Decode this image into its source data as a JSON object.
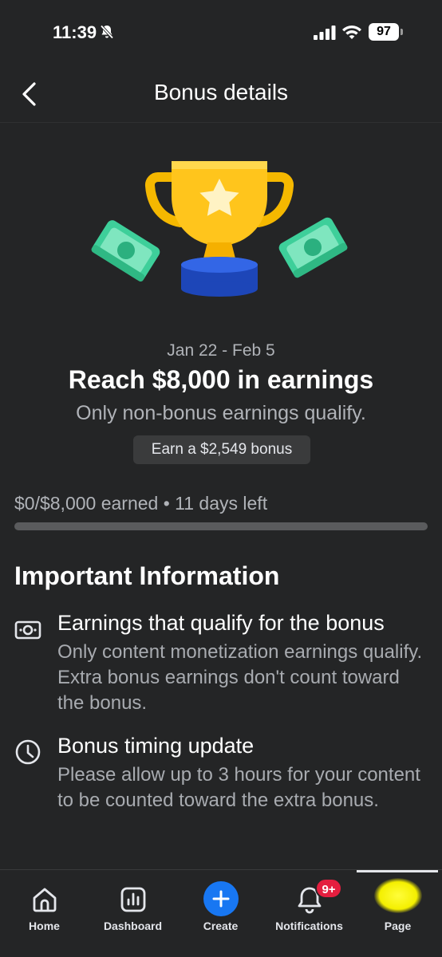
{
  "status_bar": {
    "time": "11:39",
    "battery": "97",
    "icons": [
      "bell-off-icon",
      "signal-icon",
      "wifi-icon",
      "battery-icon"
    ]
  },
  "header": {
    "title": "Bonus details",
    "back_icon": "chevron-left-icon"
  },
  "hero": {
    "icons": [
      "trophy-icon",
      "money-bill-icon"
    ]
  },
  "bonus": {
    "date_range": "Jan 22 - Feb 5",
    "title": "Reach $8,000 in earnings",
    "subtitle": "Only non-bonus earnings qualify.",
    "chip": "Earn a $2,549 bonus",
    "progress_text": "$0/$8,000 earned • 11 days left",
    "progress_fraction": 0
  },
  "info": {
    "section_title": "Important Information",
    "items": [
      {
        "icon": "money-icon",
        "heading": "Earnings that qualify for the bonus",
        "body": "Only content monetization earnings qualify. Extra bonus earnings don't count toward the bonus."
      },
      {
        "icon": "clock-icon",
        "heading": "Bonus timing update",
        "body": "Please allow up to 3 hours for your content to be counted toward the extra bonus."
      }
    ]
  },
  "bottom_nav": {
    "items": [
      {
        "label": "Home",
        "icon": "home-icon"
      },
      {
        "label": "Dashboard",
        "icon": "dashboard-icon"
      },
      {
        "label": "Create",
        "icon": "plus-icon"
      },
      {
        "label": "Notifications",
        "icon": "bell-icon",
        "badge": "9+"
      },
      {
        "label": "Page",
        "icon": "page-avatar"
      }
    ],
    "active": "Page"
  },
  "colors": {
    "background": "#242526",
    "accent": "#1877f2",
    "badge": "#e41e3f"
  }
}
